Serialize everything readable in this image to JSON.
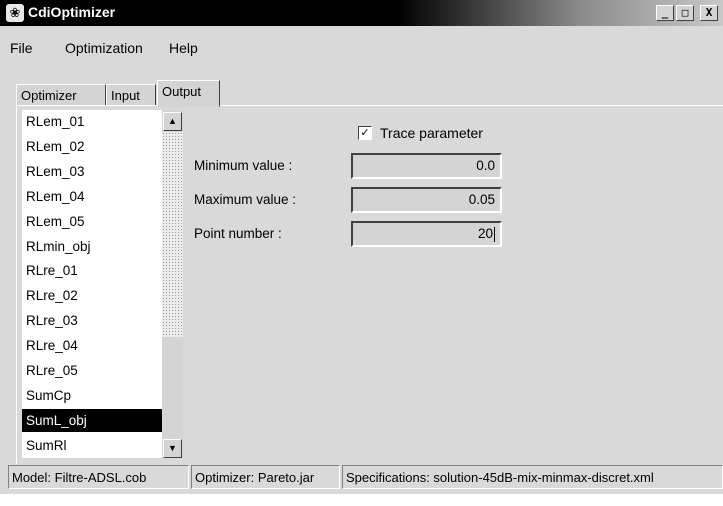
{
  "window": {
    "title": "CdiOptimizer",
    "icon": "app-icon",
    "buttons": {
      "minimize": "_",
      "maximize": "□",
      "close": "X"
    }
  },
  "menu": {
    "items": [
      {
        "label": "File"
      },
      {
        "label": "Optimization"
      },
      {
        "label": "Help"
      }
    ]
  },
  "tabs": {
    "items": [
      {
        "label": "Optimizer"
      },
      {
        "label": "Input"
      },
      {
        "label": "Output"
      }
    ],
    "active": "Output"
  },
  "list": {
    "items": [
      "RLem_01",
      "RLem_02",
      "RLem_03",
      "RLem_04",
      "RLem_05",
      "RLmin_obj",
      "RLre_01",
      "RLre_02",
      "RLre_03",
      "RLre_04",
      "RLre_05",
      "SumCp",
      "SumL_obj",
      "SumRl"
    ],
    "selected": "SumL_obj"
  },
  "form": {
    "trace_label": "Trace parameter",
    "trace_checked": true,
    "min_label": "Minimum value :",
    "min_value": "0.0",
    "max_label": "Maximum value :",
    "max_value": "0.05",
    "points_label": "Point number :",
    "points_value": "20"
  },
  "status": {
    "model": "Model: Filtre-ADSL.cob",
    "optimizer": "Optimizer: Pareto.jar",
    "specs": "Specifications: solution-45dB-mix-minmax-discret.xml"
  }
}
